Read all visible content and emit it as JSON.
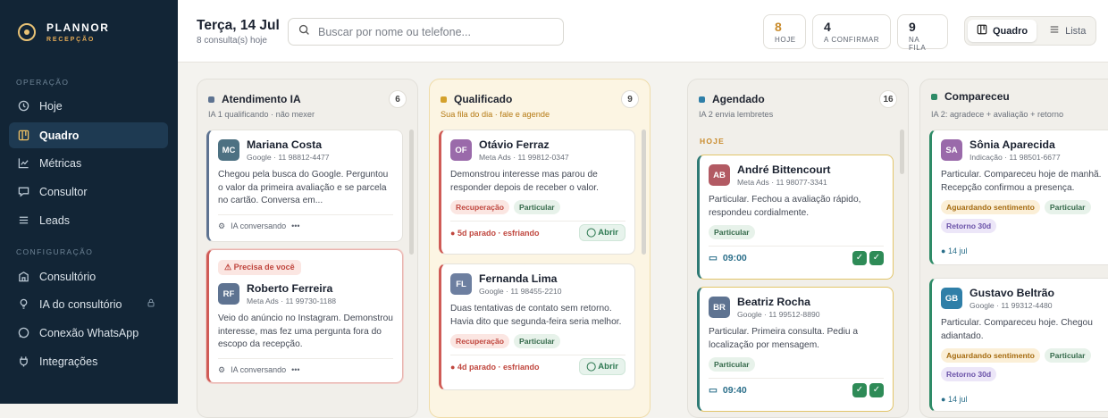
{
  "brand": {
    "name": "PLANNOR",
    "sub": "RECEPÇÃO"
  },
  "sidebar": {
    "sec_operacao": "OPERAÇÃO",
    "sec_config": "CONFIGURAÇÃO",
    "items": [
      {
        "label": "Hoje",
        "icon": "clock-icon"
      },
      {
        "label": "Quadro",
        "icon": "board-icon"
      },
      {
        "label": "Métricas",
        "icon": "chart-icon"
      },
      {
        "label": "Consultor",
        "icon": "chat-icon"
      },
      {
        "label": "Leads",
        "icon": "list-icon"
      },
      {
        "label": "Consultório",
        "icon": "building-icon"
      },
      {
        "label": "IA do consultório",
        "icon": "bulb-icon"
      },
      {
        "label": "Conexão WhatsApp",
        "icon": "whatsapp-icon"
      },
      {
        "label": "Integrações",
        "icon": "plug-icon"
      }
    ]
  },
  "header": {
    "date": "Terça, 14 Jul",
    "count": "8 consulta(s) hoje",
    "search_placeholder": "Buscar por nome ou telefone...",
    "stats": [
      {
        "n": "8",
        "l": "HOJE"
      },
      {
        "n": "4",
        "l": "A CONFIRMAR"
      },
      {
        "n": "9",
        "l": "NA FILA"
      }
    ],
    "view_board": "Quadro",
    "view_list": "Lista"
  },
  "columns": [
    {
      "title": "Atendimento IA",
      "count": "6",
      "sub": "IA 1 qualificando · não mexer",
      "cards": [
        {
          "initials": "MC",
          "name": "Mariana Costa",
          "meta": "Google · 11 98812-4477",
          "text": "Chegou pela busca do Google. Perguntou o valor da primeira avaliação e se parcela no cartão. Conversa em...",
          "foot": "IA conversando"
        },
        {
          "flag": "Precisa de você",
          "initials": "RF",
          "name": "Roberto Ferreira",
          "meta": "Meta Ads · 11 99730-1188",
          "text": "Veio do anúncio no Instagram. Demonstrou interesse, mas fez uma pergunta fora do escopo da recepção.",
          "foot": "IA conversando"
        }
      ]
    },
    {
      "title": "Qualificado",
      "count": "9",
      "sub": "Sua fila do dia · fale e agende",
      "cards": [
        {
          "initials": "OF",
          "name": "Otávio Ferraz",
          "meta": "Meta Ads · 11 99812-0347",
          "text": "Demonstrou interesse mas parou de responder depois de receber o valor.",
          "tags": [
            "Recuperação",
            "Particular"
          ],
          "status": "5d parado · esfriando",
          "action": "Abrir"
        },
        {
          "initials": "FL",
          "name": "Fernanda Lima",
          "meta": "Google · 11 98455-2210",
          "text": "Duas tentativas de contato sem retorno. Havia dito que segunda-feira seria melhor.",
          "tags": [
            "Recuperação",
            "Particular"
          ],
          "status": "4d parado · esfriando",
          "action": "Abrir"
        }
      ]
    },
    {
      "title": "Agendado",
      "count": "16",
      "sub": "IA 2 envia lembretes",
      "group": "HOJE",
      "cards": [
        {
          "initials": "AB",
          "name": "André Bittencourt",
          "meta": "Meta Ads · 11 98077-3341",
          "text": "Particular. Fechou a avaliação rápido, respondeu cordialmente.",
          "tags": [
            "Particular"
          ],
          "time": "09:00"
        },
        {
          "initials": "BR",
          "name": "Beatriz Rocha",
          "meta": "Google · 11 99512-8890",
          "text": "Particular. Primeira consulta. Pediu a localização por mensagem.",
          "tags": [
            "Particular"
          ],
          "time": "09:40"
        }
      ]
    },
    {
      "title": "Compareceu",
      "sub": "IA 2: agradece + avaliação + retorno",
      "cards": [
        {
          "initials": "SA",
          "name": "Sônia Aparecida",
          "meta": "Indicação · 11 98501-6677",
          "text": "Particular. Compareceu hoje de manhã. Recepção confirmou a presença.",
          "tags": [
            "Aguardando sentimento",
            "Particular",
            "Retorno 30d"
          ],
          "date": "14 jul"
        },
        {
          "initials": "GB",
          "name": "Gustavo Beltrão",
          "meta": "Google · 11 99312-4480",
          "text": "Particular. Compareceu hoje. Chegou adiantado.",
          "tags": [
            "Aguardando sentimento",
            "Particular",
            "Retorno 30d"
          ],
          "date": "14 jul"
        }
      ]
    }
  ],
  "colors": {
    "sidebar": "#122536",
    "accent": "#f0c063",
    "green": "#2e8b57",
    "red": "#c0473f"
  }
}
